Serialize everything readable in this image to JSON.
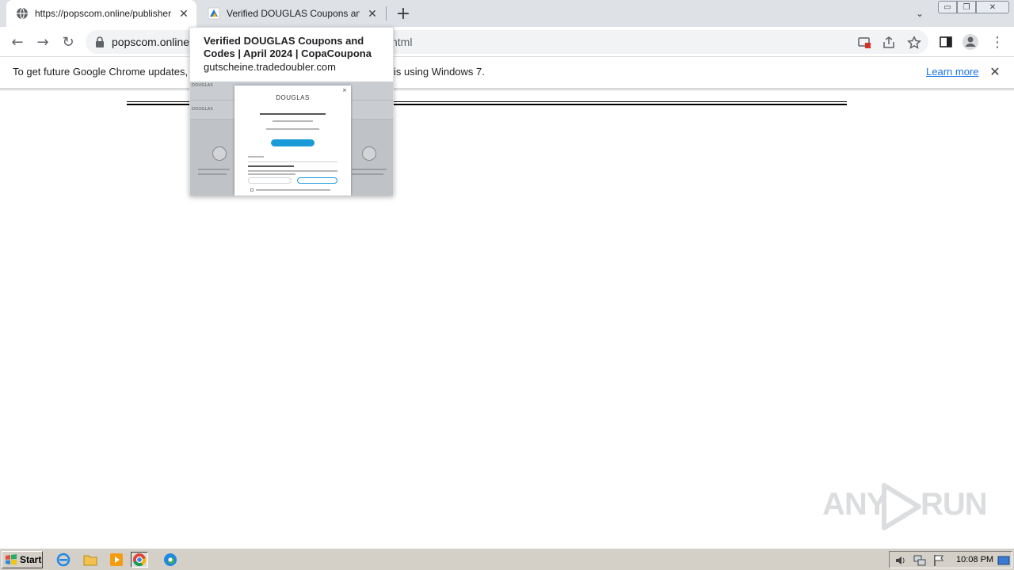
{
  "tabs": [
    {
      "title": "https://popscom.online/publishers/a",
      "active": true
    },
    {
      "title": "Verified DOUGLAS Coupons and Cod",
      "active": false
    }
  ],
  "icons": {
    "tab1_favicon": "globe-icon",
    "tab2_favicon": "copacoupona-favicon-icon",
    "new_tab": "plus-icon",
    "back": "arrow-left-icon",
    "forward": "arrow-right-icon",
    "reload": "reload-icon",
    "lock": "lock-icon",
    "cast": "cast-icon",
    "share": "share-icon",
    "bookmark": "star-icon",
    "sidepanel": "side-panel-icon",
    "profile": "profile-icon",
    "menu": "kebab-menu-icon"
  },
  "glyphs": {
    "tab_close": "✕",
    "new_tab": "+",
    "tab_search": "⌄",
    "back": "←",
    "forward": "→",
    "reload": "↻",
    "menu": "⋮",
    "infobar_close": "✕",
    "win_min": "▭",
    "win_max": "❐",
    "win_close": "✕"
  },
  "address_bar": {
    "url_visible": "popscom.online",
    "url_tail": "ntml"
  },
  "infobar": {
    "message_left": "To get future Google Chrome updates, y",
    "message_right": "is using Windows 7.",
    "link": "Learn more"
  },
  "hover_card": {
    "title": "Verified DOUGLAS Coupons and Codes | April 2024 | CopaCoupona",
    "domain": "gutscheine.tradedoubler.com",
    "preview": {
      "brand": "DOUGLAS",
      "modal_close": "×"
    }
  },
  "watermark": {
    "text_left": "ANY",
    "text_right": "RUN"
  },
  "taskbar": {
    "start_label": "Start",
    "clock": "10:08 PM"
  },
  "colors": {
    "tabstrip_bg": "#dee1e6",
    "link": "#1a73e8",
    "taskbar_bg": "#d4d0c8",
    "preview_button": "#1a9bd7"
  }
}
